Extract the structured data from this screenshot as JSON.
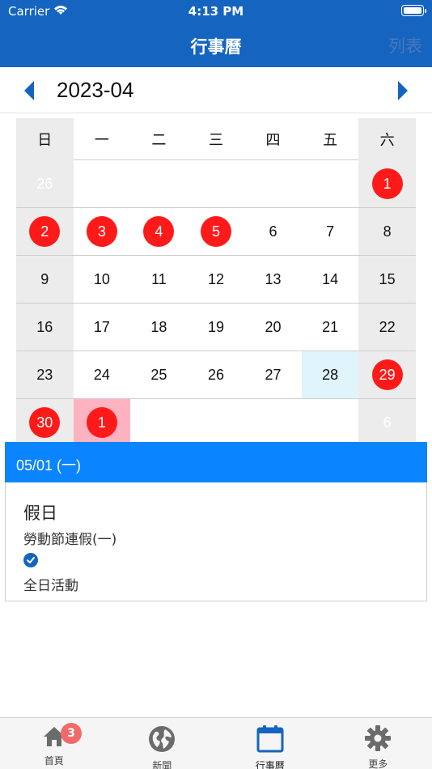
{
  "status_bar": {
    "carrier": "Carrier",
    "time": "4:13 PM"
  },
  "nav": {
    "title": "行事曆",
    "right_button": "列表"
  },
  "month_selector": {
    "label": "2023-04",
    "prev_icon": "chevron-left-icon",
    "next_icon": "chevron-right-icon"
  },
  "calendar": {
    "weekdays": [
      "日",
      "一",
      "二",
      "三",
      "四",
      "五",
      "六"
    ],
    "weeks": [
      [
        {
          "d": "26",
          "m": true
        },
        {
          "d": ""
        },
        {
          "d": ""
        },
        {
          "d": ""
        },
        {
          "d": ""
        },
        {
          "d": ""
        },
        {
          "d": "1",
          "e": true
        }
      ],
      [
        {
          "d": "2",
          "e": true
        },
        {
          "d": "3",
          "e": true
        },
        {
          "d": "4",
          "e": true
        },
        {
          "d": "5",
          "e": true
        },
        {
          "d": "6"
        },
        {
          "d": "7"
        },
        {
          "d": "8"
        }
      ],
      [
        {
          "d": "9"
        },
        {
          "d": "10"
        },
        {
          "d": "11"
        },
        {
          "d": "12"
        },
        {
          "d": "13"
        },
        {
          "d": "14"
        },
        {
          "d": "15"
        }
      ],
      [
        {
          "d": "16"
        },
        {
          "d": "17"
        },
        {
          "d": "18"
        },
        {
          "d": "19"
        },
        {
          "d": "20"
        },
        {
          "d": "21"
        },
        {
          "d": "22"
        }
      ],
      [
        {
          "d": "23"
        },
        {
          "d": "24"
        },
        {
          "d": "25"
        },
        {
          "d": "26"
        },
        {
          "d": "27"
        },
        {
          "d": "28",
          "today": true
        },
        {
          "d": "29",
          "e": true
        }
      ],
      [
        {
          "d": "30",
          "e": true
        },
        {
          "d": "1",
          "e": true,
          "sel": true
        },
        {
          "d": ""
        },
        {
          "d": ""
        },
        {
          "d": ""
        },
        {
          "d": ""
        },
        {
          "d": "6",
          "m": true
        }
      ]
    ],
    "colors": {
      "event": "#ff1a1a",
      "today": "#dff4fb",
      "selected": "#ffb3c1",
      "weekend": "#ececec"
    }
  },
  "detail": {
    "date_header": "05/01 (一)",
    "event_title": "假日",
    "event_subtitle": "勞動節連假(一)",
    "check_icon": "check-circle-icon",
    "all_day_label": "全日活動"
  },
  "tabbar": {
    "tabs": [
      {
        "label": "首頁",
        "icon": "home-icon",
        "badge": "3"
      },
      {
        "label": "新聞",
        "icon": "globe-icon"
      },
      {
        "label": "行事曆",
        "icon": "calendar-icon",
        "active": true
      },
      {
        "label": "更多",
        "icon": "gear-icon"
      }
    ]
  },
  "colors": {
    "primary": "#1565c0",
    "accent": "#0b84ff"
  }
}
